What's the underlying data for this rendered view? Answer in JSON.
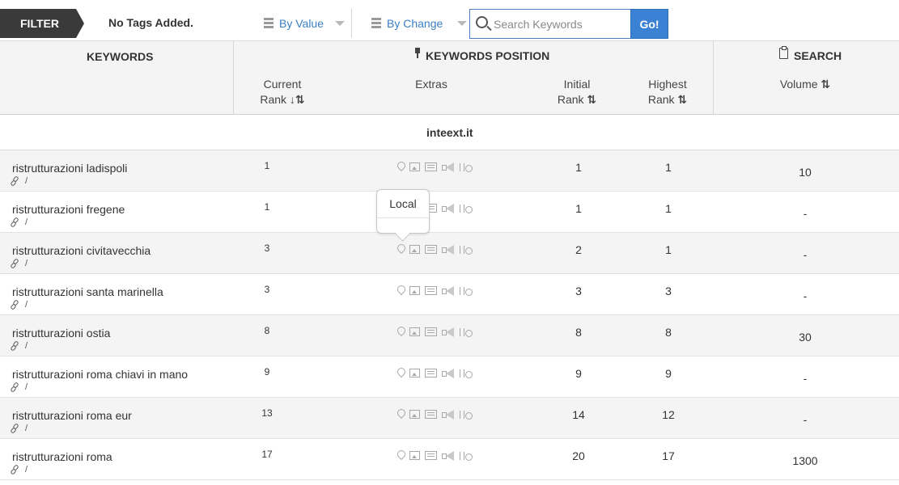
{
  "filter": {
    "label": "FILTER",
    "tags_text": "No Tags Added.",
    "by_value_label": "By Value",
    "by_change_label": "By Change",
    "search_placeholder": "Search Keywords",
    "search_value": "",
    "go_label": "Go!"
  },
  "header": {
    "keywords": "KEYWORDS",
    "keywords_position": "KEYWORDS POSITION",
    "search": "SEARCH",
    "current": "Current",
    "rank": "Rank",
    "extras": "Extras",
    "initial": "Initial",
    "highest": "Highest",
    "volume": "Volume",
    "sort_desc": "↓⇅",
    "sort_both": "⇅"
  },
  "domain": "inteext.it",
  "tooltip": "Local",
  "rows": [
    {
      "keyword": "ristrutturazioni ladispoli",
      "link_suffix": "/",
      "current_rank": "1",
      "initial_rank": "1",
      "highest_rank": "1",
      "volume": "10"
    },
    {
      "keyword": "ristrutturazioni fregene",
      "link_suffix": "/",
      "current_rank": "1",
      "initial_rank": "1",
      "highest_rank": "1",
      "volume": "-"
    },
    {
      "keyword": "ristrutturazioni civitavecchia",
      "link_suffix": "/",
      "current_rank": "3",
      "initial_rank": "2",
      "highest_rank": "1",
      "volume": "-"
    },
    {
      "keyword": "ristrutturazioni santa marinella",
      "link_suffix": "/",
      "current_rank": "3",
      "initial_rank": "3",
      "highest_rank": "3",
      "volume": "-"
    },
    {
      "keyword": "ristrutturazioni ostia",
      "link_suffix": "/",
      "current_rank": "8",
      "initial_rank": "8",
      "highest_rank": "8",
      "volume": "30"
    },
    {
      "keyword": "ristrutturazioni roma chiavi in mano",
      "link_suffix": "/",
      "current_rank": "9",
      "initial_rank": "9",
      "highest_rank": "9",
      "volume": "-"
    },
    {
      "keyword": "ristrutturazioni roma eur",
      "link_suffix": "/",
      "current_rank": "13",
      "initial_rank": "14",
      "highest_rank": "12",
      "volume": "-"
    },
    {
      "keyword": "ristrutturazioni roma",
      "link_suffix": "/",
      "current_rank": "17",
      "initial_rank": "20",
      "highest_rank": "17",
      "volume": "1300"
    }
  ]
}
